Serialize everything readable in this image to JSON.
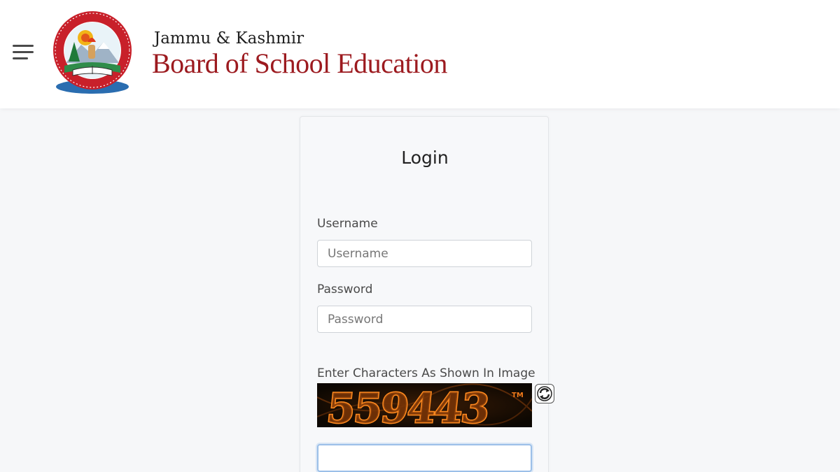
{
  "header": {
    "brand_top": "Jammu & Kashmir",
    "brand_main": "Board of School Education",
    "logo_icon": "jkbose-emblem-icon",
    "menu_icon": "hamburger-menu-icon"
  },
  "login": {
    "title": "Login",
    "username_label": "Username",
    "username_placeholder": "Username",
    "password_label": "Password",
    "password_placeholder": "Password",
    "captcha_label": "Enter Characters As Shown In Image",
    "captcha_text": "559443",
    "captcha_mark": "TM",
    "captcha_input_value": "",
    "refresh_icon": "refresh-icon"
  },
  "colors": {
    "brand_red": "#9c1a1f",
    "captcha_orange": "#f07a1a",
    "page_bg": "#f6f7f9"
  }
}
